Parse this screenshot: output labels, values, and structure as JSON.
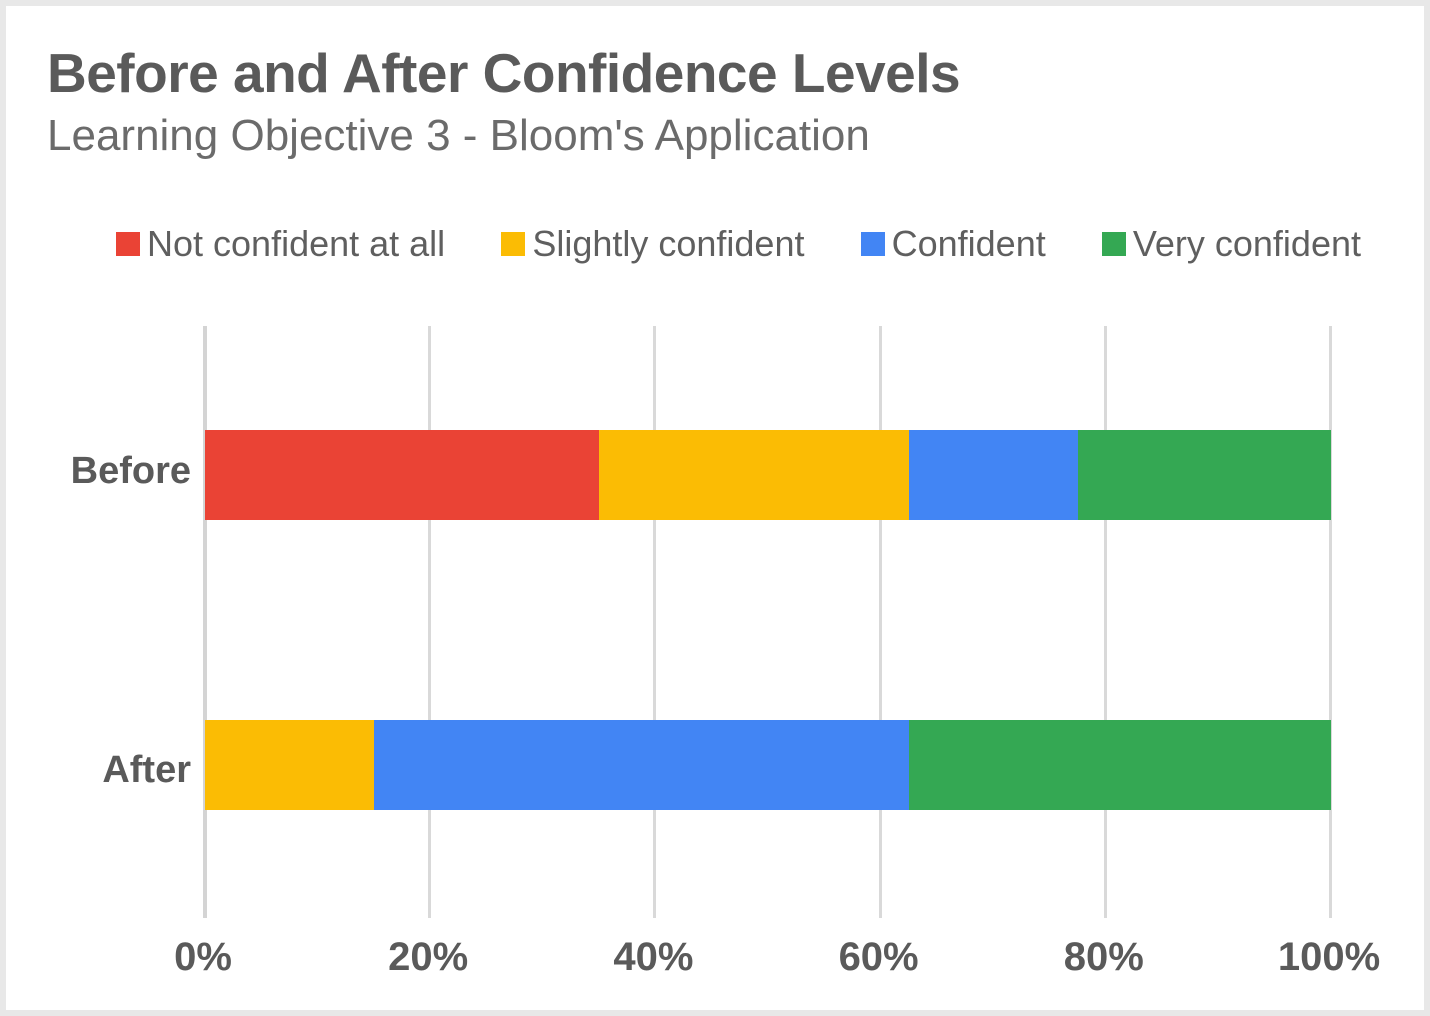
{
  "header": {
    "title": "Before and After Confidence Levels",
    "subtitle": "Learning Objective 3 - Bloom's Application"
  },
  "legend": {
    "position": "top",
    "items": [
      {
        "label": "Not confident at all",
        "color": "#EA4335",
        "swatch_icon": "square-swatch-icon"
      },
      {
        "label": "Slightly confident",
        "color": "#FBBC04",
        "swatch_icon": "square-swatch-icon"
      },
      {
        "label": "Confident",
        "color": "#4285F4",
        "swatch_icon": "square-swatch-icon"
      },
      {
        "label": "Very confident",
        "color": "#34A853",
        "swatch_icon": "square-swatch-icon"
      }
    ]
  },
  "axis": {
    "x_ticks": [
      "0%",
      "20%",
      "40%",
      "60%",
      "80%",
      "100%"
    ],
    "y_categories": [
      "Before",
      "After"
    ]
  },
  "chart_data": {
    "type": "bar",
    "orientation": "horizontal",
    "stacked": true,
    "stack_mode": "percent",
    "title": "Before and After Confidence Levels",
    "subtitle": "Learning Objective 3 - Bloom's Application",
    "xlabel": "",
    "ylabel": "",
    "categories": [
      "Before",
      "After"
    ],
    "xlim": [
      0,
      100
    ],
    "x_tick_values": [
      0,
      20,
      40,
      60,
      80,
      100
    ],
    "x_tick_labels": [
      "0%",
      "20%",
      "40%",
      "60%",
      "80%",
      "100%"
    ],
    "grid": true,
    "grid_axis": "x",
    "legend_position": "top",
    "series": [
      {
        "name": "Not confident at all",
        "color": "#EA4335",
        "values": [
          35.0,
          0.0
        ]
      },
      {
        "name": "Slightly confident",
        "color": "#FBBC04",
        "values": [
          27.5,
          15.0
        ]
      },
      {
        "name": "Confident",
        "color": "#4285F4",
        "values": [
          15.0,
          47.5
        ]
      },
      {
        "name": "Very confident",
        "color": "#34A853",
        "values": [
          22.5,
          37.5
        ]
      }
    ]
  }
}
